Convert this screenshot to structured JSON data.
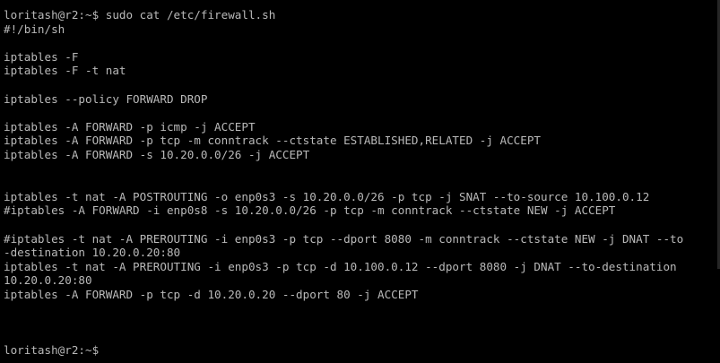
{
  "terminal": {
    "lines": [
      "loritash@r2:~$ sudo cat /etc/firewall.sh",
      "#!/bin/sh",
      "",
      "iptables -F",
      "iptables -F -t nat",
      "",
      "iptables --policy FORWARD DROP",
      "",
      "iptables -A FORWARD -p icmp -j ACCEPT",
      "iptables -A FORWARD -p tcp -m conntrack --ctstate ESTABLISHED,RELATED -j ACCEPT",
      "iptables -A FORWARD -s 10.20.0.0/26 -j ACCEPT",
      "",
      "",
      "iptables -t nat -A POSTROUTING -o enp0s3 -s 10.20.0.0/26 -p tcp -j SNAT --to-source 10.100.0.12",
      "#iptables -A FORWARD -i enp0s8 -s 10.20.0.0/26 -p tcp -m conntrack --ctstate NEW -j ACCEPT",
      "",
      "#iptables -t nat -A PREROUTING -i enp0s3 -p tcp --dport 8080 -m conntrack --ctstate NEW -j DNAT --to",
      "-destination 10.20.0.20:80",
      "iptables -t nat -A PREROUTING -i enp0s3 -p tcp -d 10.100.0.12 --dport 8080 -j DNAT --to-destination",
      "10.20.0.20:80",
      "iptables -A FORWARD -p tcp -d 10.20.0.20 --dport 80 -j ACCEPT",
      "",
      "",
      "",
      "loritash@r2:~$ "
    ],
    "colors": {
      "background": "#000000",
      "text": "#b9b9b9"
    }
  }
}
